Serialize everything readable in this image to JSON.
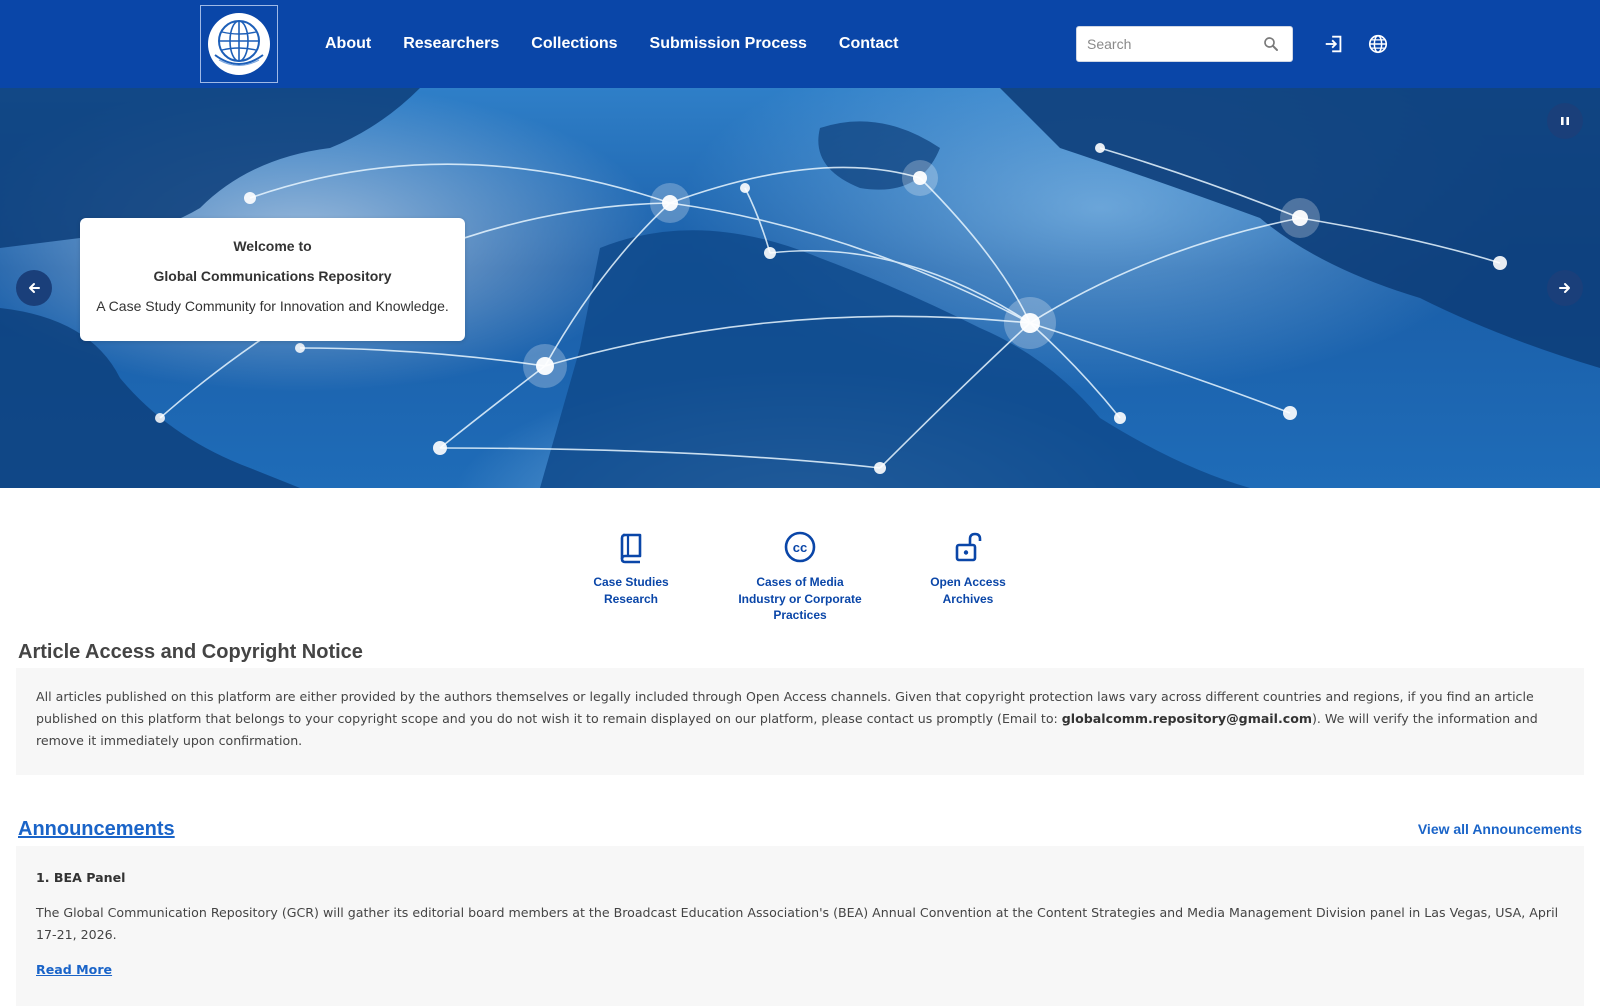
{
  "header": {
    "logo_alt": "Global Communications Repository",
    "nav": [
      "About",
      "Researchers",
      "Collections",
      "Submission Process",
      "Contact"
    ],
    "search_placeholder": "Search",
    "icons": [
      "search-icon",
      "login-icon",
      "language-globe-icon"
    ]
  },
  "hero": {
    "welcome_line1": "Welcome to",
    "welcome_line2": "Global Communications Repository",
    "welcome_line3": "A Case Study Community for Innovation and Knowledge.",
    "controls": [
      "pause-icon",
      "arrow-left-icon",
      "arrow-right-icon"
    ]
  },
  "quick_links": [
    {
      "label_line1": "Case Studies",
      "label_line2": "Research",
      "label_line3": "",
      "icon": "book-icon"
    },
    {
      "label_line1": "Cases of Media",
      "label_line2": "Industry or Corporate",
      "label_line3": "Practices",
      "icon": "creative-commons-icon"
    },
    {
      "label_line1": "Open Access",
      "label_line2": "Archives",
      "label_line3": "",
      "icon": "open-lock-icon"
    }
  ],
  "notice": {
    "title": "Article Access and Copyright Notice",
    "text_before": "All articles published on this platform are either provided by the authors themselves or legally included through Open Access channels. Given that copyright protection laws vary across different countries and regions, if you find an article published on this platform that belongs to your copyright scope and you do not wish it to remain displayed on our platform, please contact us promptly (Email to: ",
    "email": "globalcomm.repository@gmail.com",
    "text_after": "). We will verify the information and remove it immediately upon confirmation."
  },
  "announcements": {
    "title": "Announcements",
    "view_all": "View all Announcements",
    "items": [
      {
        "title": "1. BEA Panel",
        "text": "The Global Communication Repository (GCR) will gather its editorial board members at the Broadcast Education Association's (BEA) Annual Convention at the Content Strategies and Media Management Division panel in Las Vegas, USA, April 17-21, 2026.",
        "read_more": "Read More"
      }
    ]
  },
  "colors": {
    "header_bg": "#0a46a8",
    "link_blue": "#1a64c8",
    "panel_bg": "#f7f7f7"
  }
}
